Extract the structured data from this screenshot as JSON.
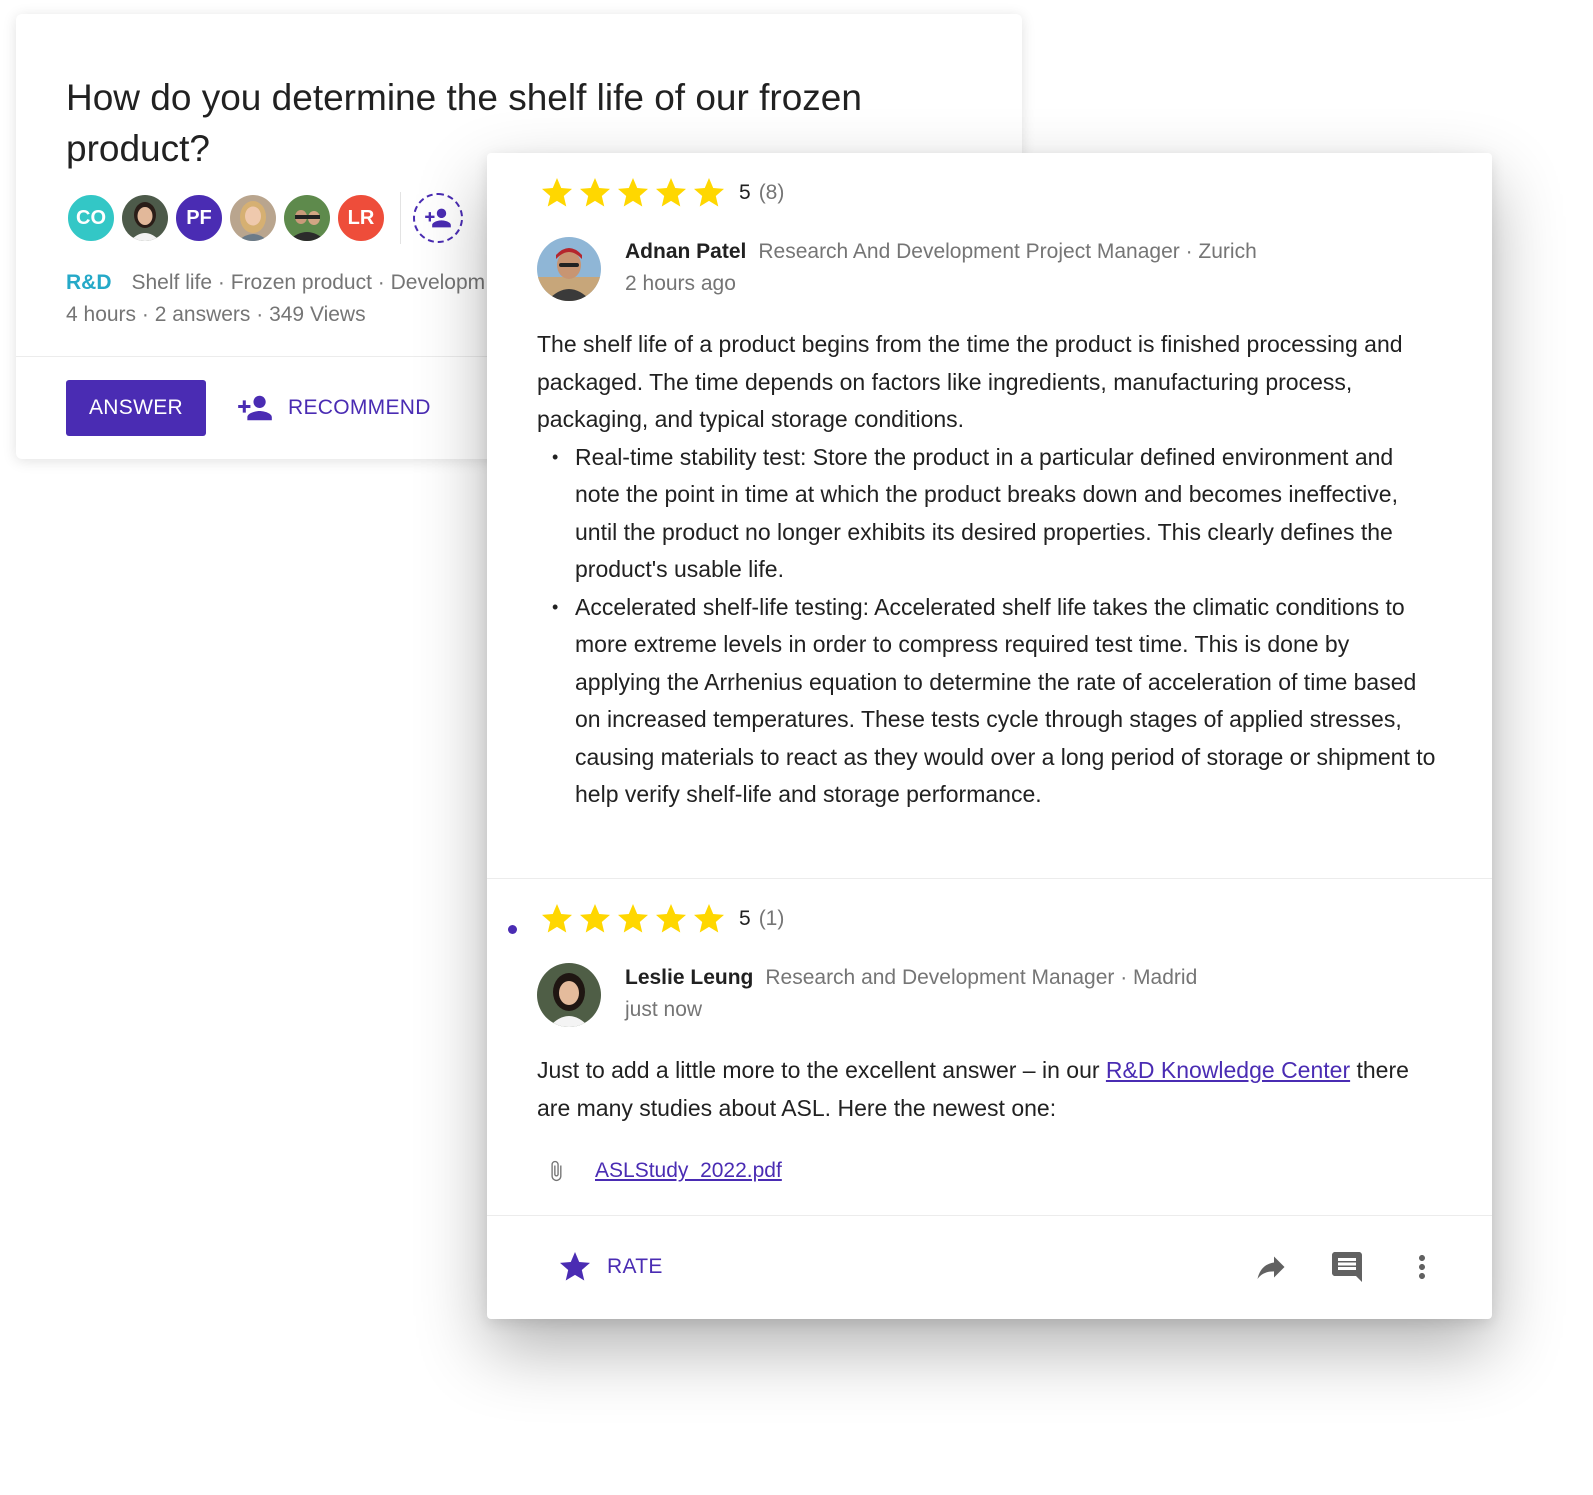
{
  "question": {
    "title": "How do you determine the shelf life of our frozen product?",
    "participants": [
      {
        "initials": "CO",
        "color": "#33c7c6"
      },
      {
        "initials": "",
        "type": "photo"
      },
      {
        "initials": "PF",
        "color": "#4a2cb3"
      },
      {
        "initials": "",
        "type": "photo"
      },
      {
        "initials": "",
        "type": "photo"
      },
      {
        "initials": "LR",
        "color": "#ee4d3a"
      }
    ],
    "primary_tag": "R&D",
    "tags_text": "Shelf life · Frozen product · Development",
    "meta": "4 hours · 2 answers · 349 Views",
    "answer_label": "ANSWER",
    "recommend_label": "RECOMMEND"
  },
  "answers": [
    {
      "rating_score": "5",
      "rating_count": "(8)",
      "stars": 5,
      "author_name": "Adnan Patel",
      "author_role": "Research And Development Project Manager · Zurich",
      "time": "2 hours ago",
      "intro": "The shelf life of a product begins from the time the product is finished processing and packaged. The time depends on factors like ingredients, manufacturing process, packaging, and typical storage conditions.",
      "bullets": [
        "Real-time stability test: Store the product in a particular defined environment and note the point in time at which the product breaks down and becomes ineffective, until the product no longer exhibits its desired properties. This clearly defines the product's usable life.",
        "Accelerated shelf-life testing: Accelerated shelf life takes the climatic conditions to more extreme levels in order to compress required test time. This is done by applying the Arrhenius equation to determine the rate of acceleration of time based on increased temperatures. These tests cycle through stages of applied stresses, causing materials to react as they would over a long period of storage or shipment to help verify shelf-life and storage performance."
      ]
    },
    {
      "rating_score": "5",
      "rating_count": "(1)",
      "stars": 5,
      "author_name": "Leslie Leung",
      "author_role": "Research and Development Manager · Madrid",
      "time": "just now",
      "text_before_link": "Just to add a little more to the excellent answer – in our ",
      "link_text": "R&D Knowledge Center",
      "text_after_link": " there are many studies about ASL. Here the newest one:",
      "attachment": "ASLStudy_2022.pdf"
    }
  ],
  "footer": {
    "rate_label": "RATE",
    "icons": [
      "share-icon",
      "comment-icon",
      "more-vert-icon"
    ]
  },
  "colors": {
    "accent": "#4a2cb3",
    "star": "#ffd700",
    "tag": "#25a9c8"
  }
}
